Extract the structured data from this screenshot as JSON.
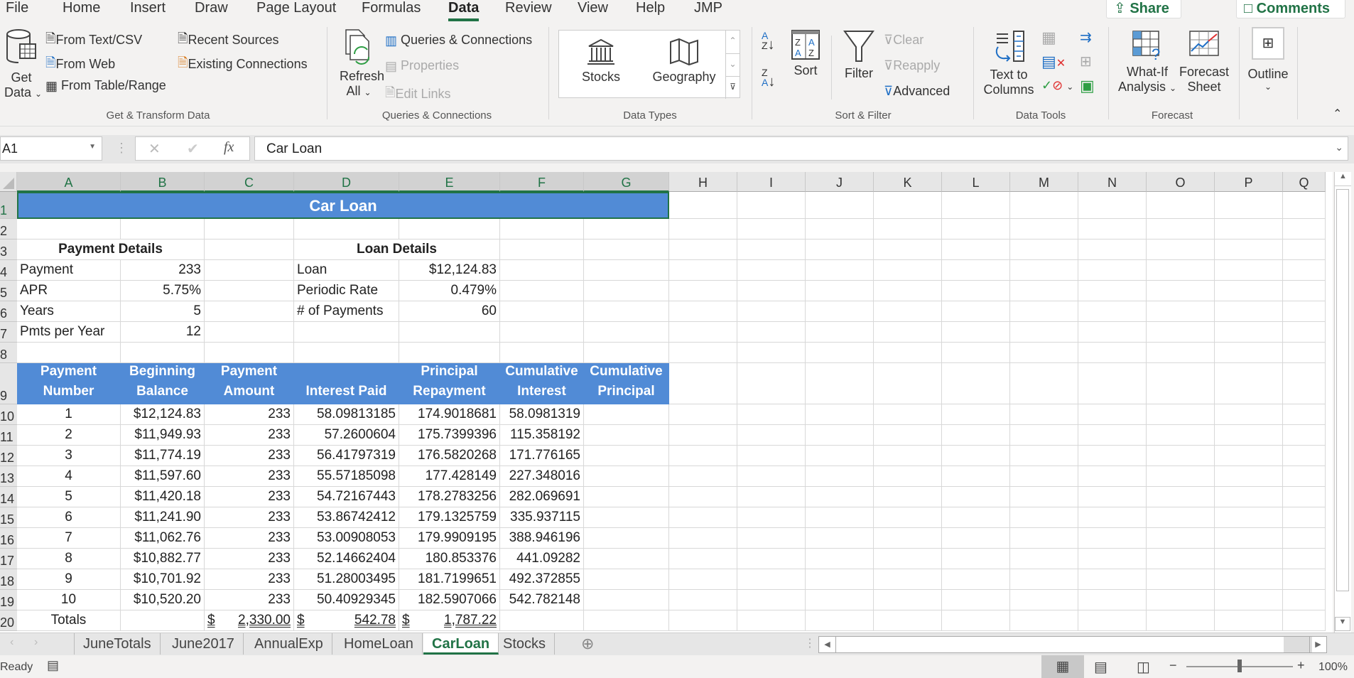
{
  "menu": {
    "tabs": [
      "File",
      "Home",
      "Insert",
      "Draw",
      "Page Layout",
      "Formulas",
      "Data",
      "Review",
      "View",
      "Help",
      "JMP"
    ],
    "active": "Data",
    "share": "Share",
    "comments": "Comments"
  },
  "ribbon": {
    "get_data": [
      "Get",
      "Data"
    ],
    "from_text": "From Text/CSV",
    "from_web": "From Web",
    "from_table": "From Table/Range",
    "recent_sources": "Recent Sources",
    "existing_connections": "Existing Connections",
    "group_get_transform": "Get & Transform Data",
    "refresh_all": [
      "Refresh",
      "All"
    ],
    "queries_connections": "Queries & Connections",
    "properties": "Properties",
    "edit_links": "Edit Links",
    "group_queries": "Queries & Connections",
    "stocks": "Stocks",
    "geography": "Geography",
    "group_data_types": "Data Types",
    "sort": "Sort",
    "filter": "Filter",
    "clear": "Clear",
    "reapply": "Reapply",
    "advanced": "Advanced",
    "group_sort_filter": "Sort & Filter",
    "text_to_columns": [
      "Text to",
      "Columns"
    ],
    "group_data_tools": "Data Tools",
    "what_if": [
      "What-If",
      "Analysis"
    ],
    "forecast_sheet": [
      "Forecast",
      "Sheet"
    ],
    "group_forecast": "Forecast",
    "outline": "Outline"
  },
  "formula_bar": {
    "name_box": "A1",
    "formula": "Car Loan"
  },
  "columns": [
    "A",
    "B",
    "C",
    "D",
    "E",
    "F",
    "G",
    "H",
    "I",
    "J",
    "K",
    "L",
    "M",
    "N",
    "O",
    "P",
    "Q"
  ],
  "rows": [
    "1",
    "2",
    "3",
    "4",
    "5",
    "6",
    "7",
    "8",
    "9",
    "10",
    "11",
    "12",
    "13",
    "14",
    "15",
    "16",
    "17",
    "18",
    "19",
    "20"
  ],
  "sheet": {
    "title": "Car Loan",
    "payment_details": {
      "heading": "Payment Details",
      "rows": [
        {
          "label": "Payment",
          "value": "233"
        },
        {
          "label": "APR",
          "value": "5.75%"
        },
        {
          "label": "Years",
          "value": "5"
        },
        {
          "label": "Pmts per Year",
          "value": "12"
        }
      ]
    },
    "loan_details": {
      "heading": "Loan Details",
      "rows": [
        {
          "label": "Loan",
          "value": "$12,124.83"
        },
        {
          "label": "Periodic Rate",
          "value": "0.479%"
        },
        {
          "label": "# of Payments",
          "value": "60"
        }
      ]
    },
    "table_headers": [
      [
        "Payment",
        "Number"
      ],
      [
        "Beginning",
        "Balance"
      ],
      [
        "Payment",
        "Amount"
      ],
      [
        "",
        "Interest Paid"
      ],
      [
        "Principal",
        "Repayment"
      ],
      [
        "Cumulative",
        "Interest"
      ],
      [
        "Cumulative",
        "Principal"
      ]
    ],
    "table_rows": [
      [
        "1",
        "$12,124.83",
        "233",
        "58.09813185",
        "174.9018681",
        "58.0981319",
        ""
      ],
      [
        "2",
        "$11,949.93",
        "233",
        "57.2600604",
        "175.7399396",
        "115.358192",
        ""
      ],
      [
        "3",
        "$11,774.19",
        "233",
        "56.41797319",
        "176.5820268",
        "171.776165",
        ""
      ],
      [
        "4",
        "$11,597.60",
        "233",
        "55.57185098",
        "177.428149",
        "227.348016",
        ""
      ],
      [
        "5",
        "$11,420.18",
        "233",
        "54.72167443",
        "178.2783256",
        "282.069691",
        ""
      ],
      [
        "6",
        "$11,241.90",
        "233",
        "53.86742412",
        "179.1325759",
        "335.937115",
        ""
      ],
      [
        "7",
        "$11,062.76",
        "233",
        "53.00908053",
        "179.9909195",
        "388.946196",
        ""
      ],
      [
        "8",
        "$10,882.77",
        "233",
        "52.14662404",
        "180.853376",
        "441.09282",
        ""
      ],
      [
        "9",
        "$10,701.92",
        "233",
        "51.28003495",
        "181.7199651",
        "492.372855",
        ""
      ],
      [
        "10",
        "$10,520.20",
        "233",
        "50.40929345",
        "182.5907066",
        "542.782148",
        ""
      ]
    ],
    "totals": {
      "label": "Totals",
      "payment_amount": "2,330.00",
      "interest_paid": "542.78",
      "principal_repayment": "1,787.22",
      "currency": "$"
    }
  },
  "sheet_tabs": [
    "JuneTotals",
    "June2017",
    "AnnualExp",
    "HomeLoan",
    "CarLoan",
    "Stocks"
  ],
  "active_sheet": "CarLoan",
  "status": {
    "ready": "Ready",
    "zoom": "100%"
  },
  "zoom_level": 100
}
